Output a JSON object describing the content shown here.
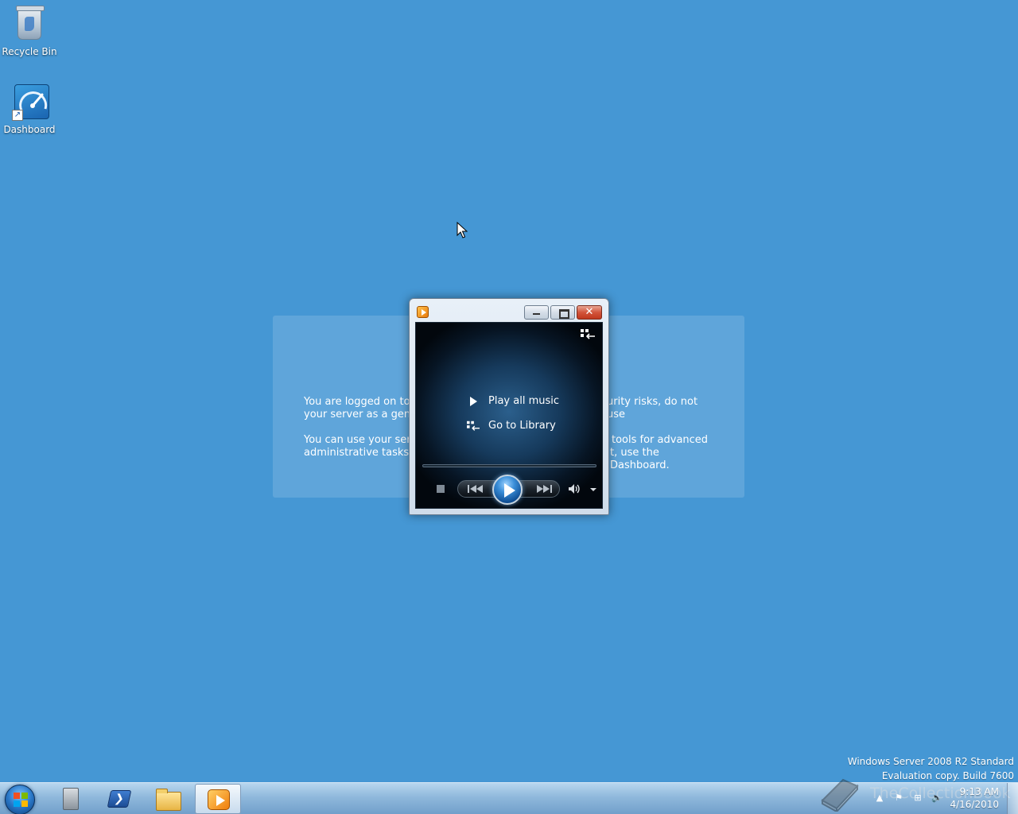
{
  "desktop": {
    "icons": [
      {
        "label": "Recycle Bin",
        "icon": "recycle-bin-icon"
      },
      {
        "label": "Dashboard",
        "icon": "dashboard-icon"
      }
    ]
  },
  "info_panel": {
    "paragraph1_line1": "You are logged on to t",
    "paragraph1_line1_right": "urity risks, do not use",
    "paragraph1_line2": "your server as a gener",
    "paragraph2_line1": "You can use your serve",
    "paragraph2_line1_right": "tools for advanced",
    "paragraph2_line2": "administrative tasks, b",
    "paragraph2_line2_right": "t, use the Dashboard."
  },
  "media_player": {
    "menu": {
      "play_all": "Play all music",
      "go_to_library": "Go to Library"
    },
    "close_glyph": "✕",
    "accent_color": "#1f6fc4"
  },
  "watermark": {
    "line1": "Windows Server 2008 R2 Standard",
    "line2": "Evaluation copy. Build 7600"
  },
  "site_watermark": "TheCollectionBook",
  "taskbar": {
    "buttons": [
      {
        "name": "server-manager",
        "icon": "server-manager-icon"
      },
      {
        "name": "powershell",
        "icon": "powershell-icon",
        "glyph": "❯"
      },
      {
        "name": "windows-explorer",
        "icon": "folder-icon"
      },
      {
        "name": "windows-media-player",
        "icon": "media-player-icon",
        "active": true
      }
    ],
    "clock": {
      "time": "9:13 AM",
      "date": "4/16/2010"
    }
  }
}
